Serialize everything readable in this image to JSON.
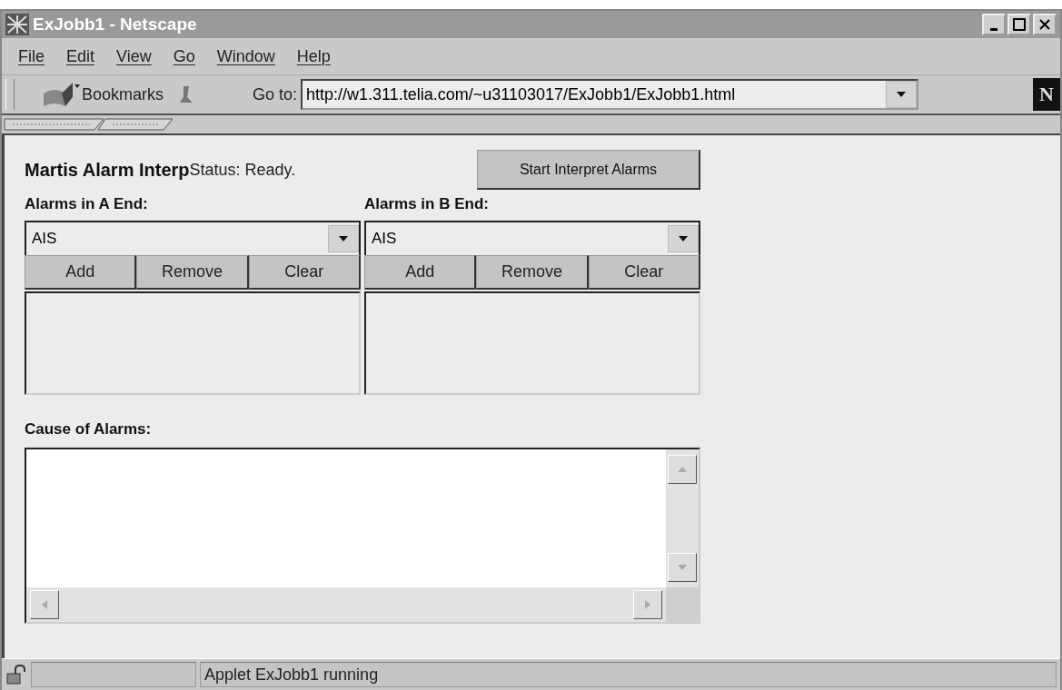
{
  "window": {
    "title": "ExJobb1 - Netscape"
  },
  "menu": [
    "File",
    "Edit",
    "View",
    "Go",
    "Window",
    "Help"
  ],
  "toolbar": {
    "bookmarks": "Bookmarks",
    "goto_label": "Go to:",
    "url": "http://w1.311.telia.com/~u31103017/ExJobb1/ExJobb1.html",
    "logo": "N"
  },
  "applet": {
    "title": "Martis Alarm Interp",
    "status": "Status: Ready.",
    "start_button": "Start Interpret Alarms",
    "ends": [
      {
        "label": "Alarms in A End:",
        "selected_alarm": "AIS",
        "buttons": [
          "Add",
          "Remove",
          "Clear"
        ]
      },
      {
        "label": "Alarms in B End:",
        "selected_alarm": "AIS",
        "buttons": [
          "Add",
          "Remove",
          "Clear"
        ]
      }
    ],
    "cause_label": "Cause of Alarms:"
  },
  "status_bar": {
    "text": "Applet ExJobb1 running"
  }
}
